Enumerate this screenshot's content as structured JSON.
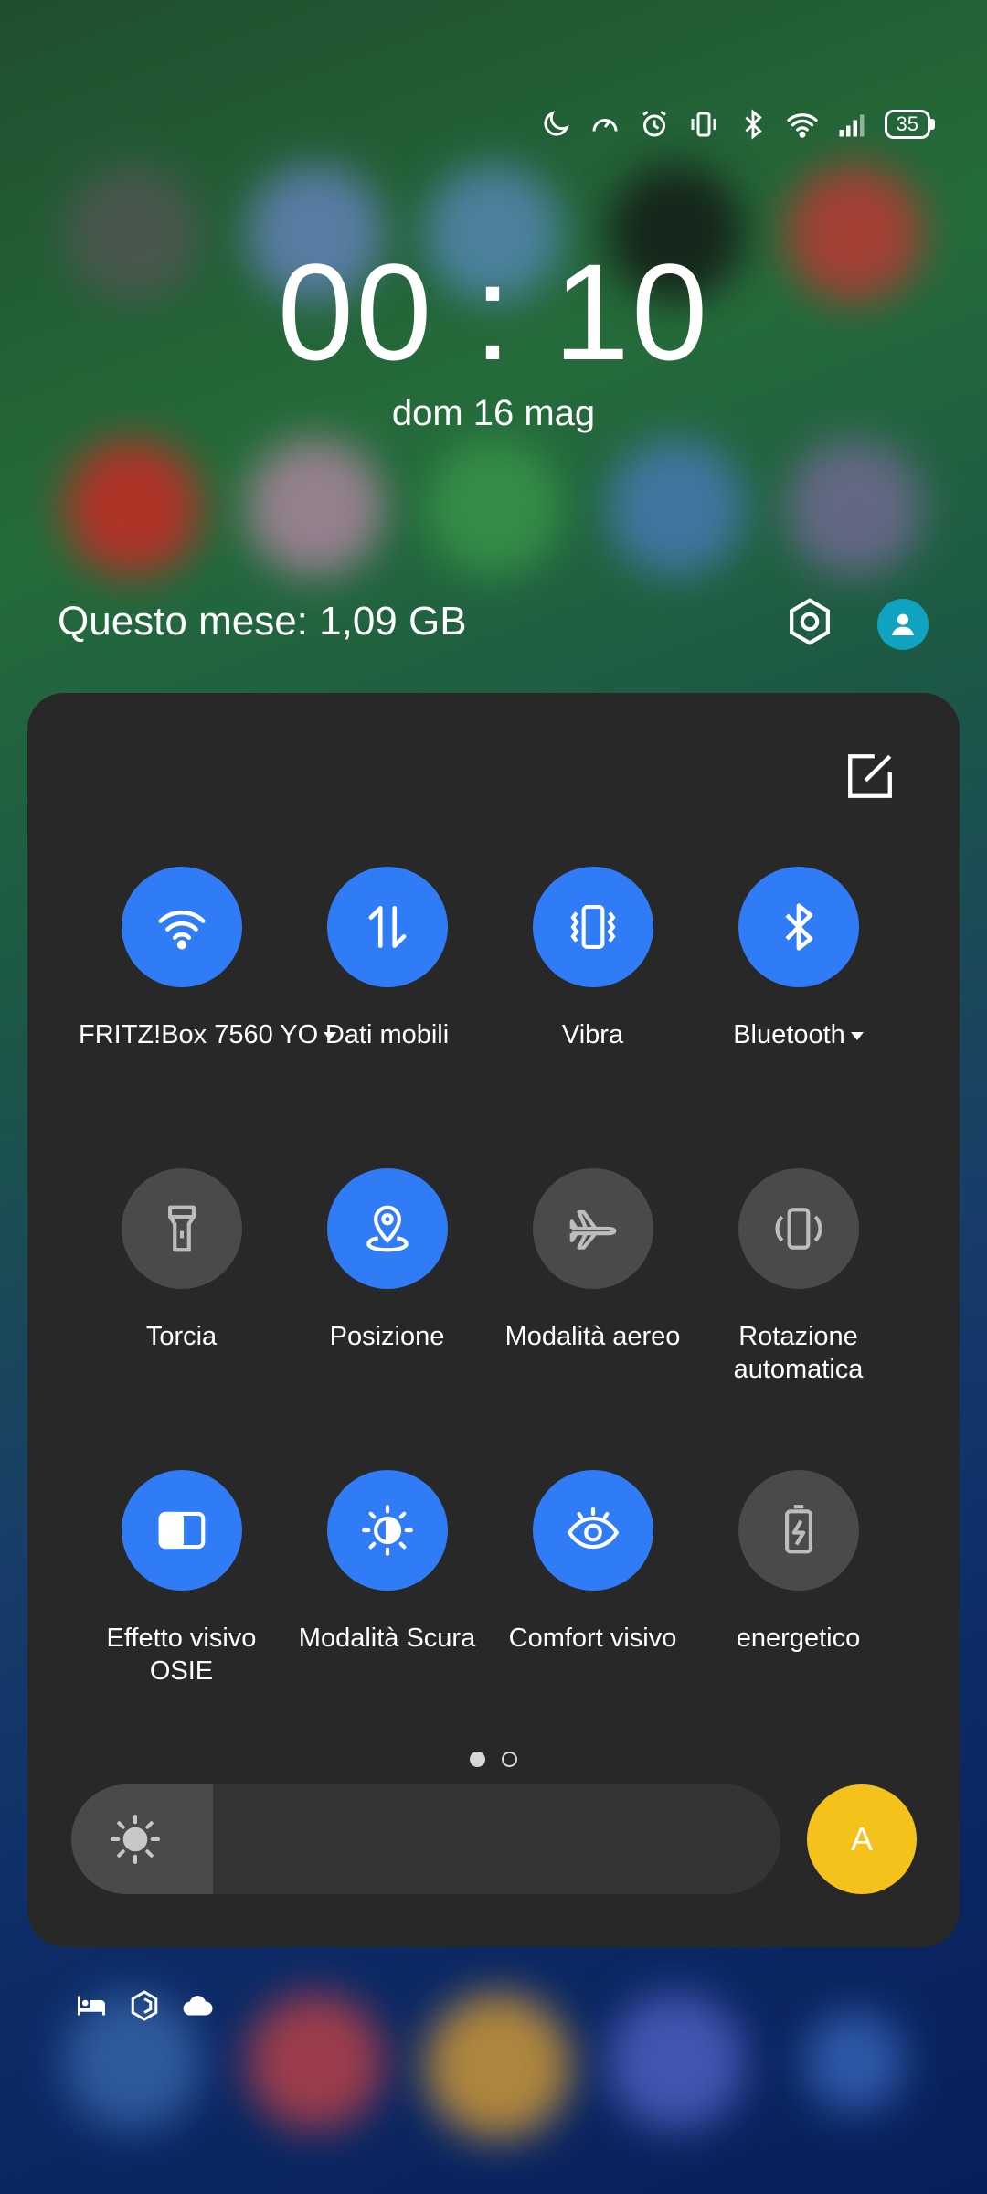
{
  "status_bar": {
    "icons": [
      "moon-icon",
      "speedometer-icon",
      "alarm-icon",
      "vibrate-icon",
      "bluetooth-icon",
      "wifi-icon",
      "signal-icon"
    ],
    "battery": "35"
  },
  "lockscreen": {
    "time": "00 : 10",
    "date": "dom 16 mag"
  },
  "header": {
    "data_usage": "Questo mese: 1,09 GB"
  },
  "quick_settings": {
    "tiles": [
      {
        "label": "FRITZ!Box 7560 YO",
        "state": "on",
        "icon": "wifi-icon"
      },
      {
        "label": "Dati mobili",
        "state": "on",
        "icon": "mobile-data-icon"
      },
      {
        "label": "Vibra",
        "state": "on",
        "icon": "vibrate-icon"
      },
      {
        "label": "Bluetooth",
        "state": "on",
        "icon": "bluetooth-icon"
      },
      {
        "label": "Torcia",
        "state": "off",
        "icon": "flashlight-icon"
      },
      {
        "label": "Posizione",
        "state": "on",
        "icon": "location-icon"
      },
      {
        "label": "Modalità aereo",
        "state": "off",
        "icon": "airplane-icon"
      },
      {
        "label": "Rotazione automatica",
        "state": "off",
        "icon": "rotate-icon"
      },
      {
        "label": "Effetto visivo OSIE",
        "state": "on",
        "icon": "osie-icon"
      },
      {
        "label": "Modalità Scura",
        "state": "on",
        "icon": "dark-mode-icon"
      },
      {
        "label": "Comfort visivo",
        "state": "on",
        "icon": "eye-icon"
      },
      {
        "label": "energetico",
        "state": "off",
        "icon": "battery-saver-icon"
      }
    ],
    "page": {
      "current": 1,
      "total": 2
    },
    "brightness": {
      "level": 0.2,
      "auto_label": "A"
    }
  },
  "notification_icons": [
    "bed-icon",
    "hexagon-icon",
    "cloud-icon"
  ],
  "colors": {
    "tile_on": "#2f7cf6",
    "tile_off": "#4a4a4a",
    "panel": "#282828",
    "auto_brightness": "#f5c21b",
    "user_avatar": "#10a3bf"
  }
}
